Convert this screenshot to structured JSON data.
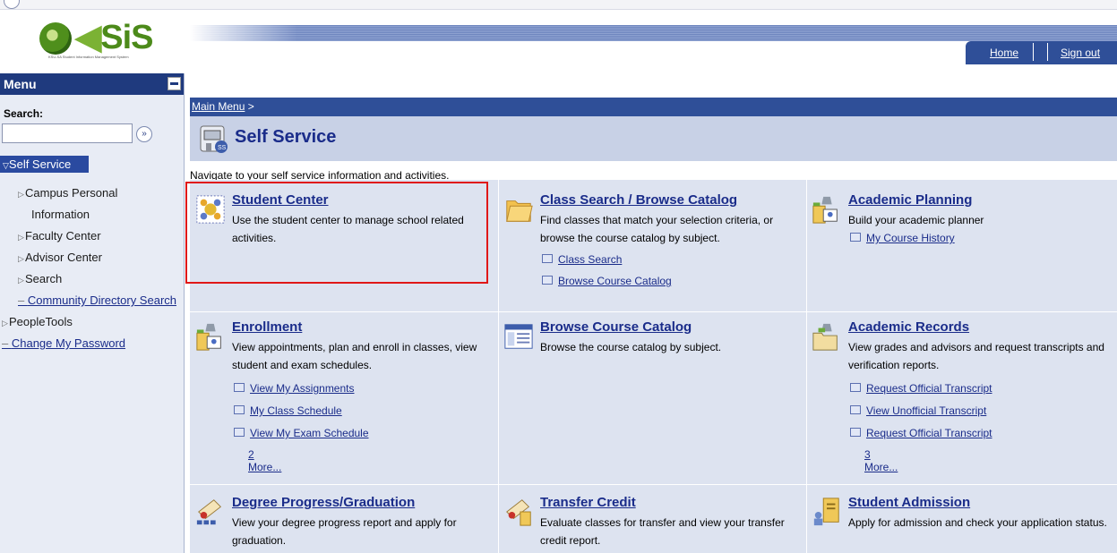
{
  "header": {
    "logo_text": "SiS",
    "logo_tagline": "KSU-SA Student Information Management System",
    "nav": {
      "home": "Home",
      "sign_out": "Sign out"
    }
  },
  "menu": {
    "title": "Menu",
    "search_label": "Search:",
    "search_value": "",
    "search_go": "»",
    "items": {
      "self_service": "Self Service",
      "campus_personal": "Campus Personal",
      "campus_personal_2": "Information",
      "faculty_center": "Faculty Center",
      "advisor_center": "Advisor Center",
      "search": "Search",
      "community": "Community Directory Search",
      "people_tools": "PeopleTools",
      "change_password": "Change My Password"
    }
  },
  "main": {
    "breadcrumb": "Main Menu",
    "breadcrumb_sep": ">",
    "page_title": "Self Service",
    "description": "Navigate to your self service information and activities.",
    "tiles": {
      "student_center": {
        "title": "Student Center",
        "desc": "Use the student center to manage school related activities."
      },
      "class_search": {
        "title": "Class Search / Browse Catalog",
        "desc": "Find classes that match your selection criteria, or browse the course catalog by subject.",
        "links": [
          "Class Search",
          "Browse Course Catalog"
        ]
      },
      "academic_planning": {
        "title": "Academic Planning",
        "desc": "Build your academic planner",
        "links": [
          "My Course History"
        ]
      },
      "enrollment": {
        "title": "Enrollment",
        "desc": "View appointments, plan and enroll in classes, view student and exam schedules.",
        "links": [
          "View My Assignments",
          "My Class Schedule",
          "View My Exam Schedule"
        ],
        "more": "2 More..."
      },
      "browse_catalog": {
        "title": "Browse Course Catalog",
        "desc": "Browse the course catalog by subject."
      },
      "academic_records": {
        "title": "Academic Records",
        "desc": "View grades and advisors and request transcripts and verification reports.",
        "links": [
          "Request Official Transcript",
          "View Unofficial Transcript",
          "Request Official Transcript"
        ],
        "more": "3 More..."
      },
      "degree_progress": {
        "title": "Degree Progress/Graduation",
        "desc": "View your degree progress report and apply for graduation."
      },
      "transfer_credit": {
        "title": "Transfer Credit",
        "desc": "Evaluate classes for transfer and view your transfer credit report."
      },
      "student_admission": {
        "title": "Student Admission",
        "desc": "Apply for admission and check your application status."
      }
    }
  },
  "colors": {
    "nav_blue": "#2f4f98",
    "link_blue": "#1a2c8a",
    "highlight_red": "#e01818"
  }
}
